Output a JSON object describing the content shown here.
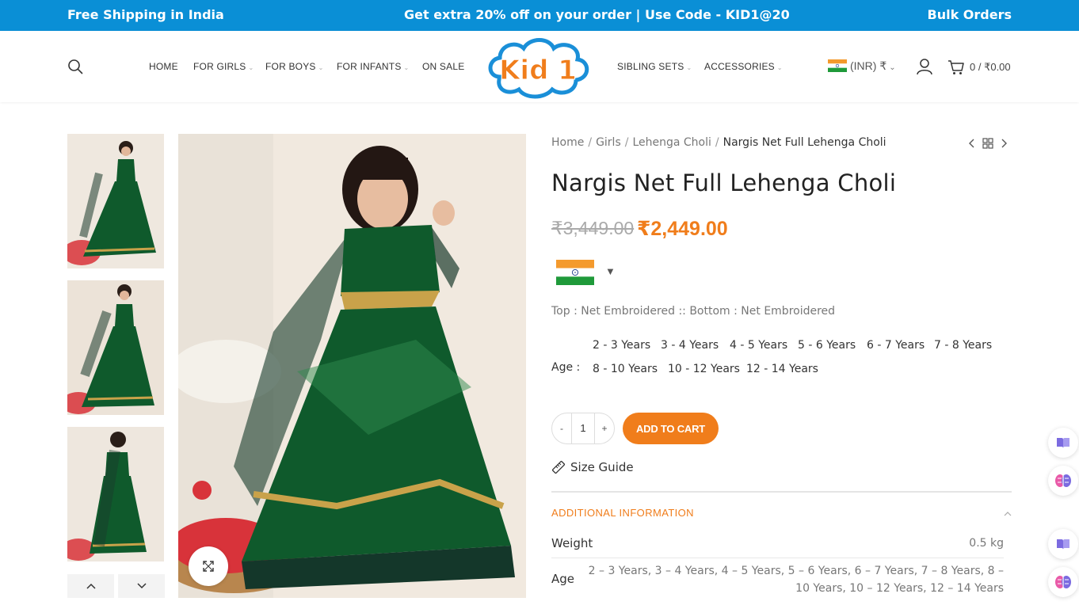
{
  "promo": {
    "left": "Free Shipping in India",
    "center": "Get extra 20% off on your order | Use Code - KID1@20",
    "right": "Bulk Orders"
  },
  "header": {
    "nav_left": [
      {
        "label": "HOME",
        "dropdown": false
      },
      {
        "label": "FOR GIRLS",
        "dropdown": true
      },
      {
        "label": "FOR BOYS",
        "dropdown": true
      },
      {
        "label": "FOR INFANTS",
        "dropdown": true
      },
      {
        "label": "ON SALE",
        "dropdown": false
      }
    ],
    "logo_text": "Kid 1",
    "nav_right": [
      {
        "label": "SIBLING SETS",
        "dropdown": true
      },
      {
        "label": "ACCESSORIES",
        "dropdown": true
      }
    ],
    "currency": "(INR) ₹",
    "cart_summary": "0 / ₹0.00"
  },
  "breadcrumb": {
    "items": [
      "Home",
      "Girls",
      "Lehenga Choli"
    ],
    "current": "Nargis Net Full Lehenga Choli"
  },
  "product": {
    "title": "Nargis Net Full Lehenga Choli",
    "price_old": "₹3,449.00",
    "price_new": "₹2,449.00",
    "material": "Top : Net Embroidered :: Bottom : Net Embroidered",
    "age_label": "Age :",
    "age_options": [
      "2 - 3 Years",
      "3 - 4 Years",
      "4 - 5 Years",
      "5 - 6 Years",
      "6 - 7 Years",
      "7 - 8 Years",
      "8 - 10 Years",
      "10 - 12 Years",
      "12 - 14 Years"
    ],
    "qty_minus": "-",
    "qty_value": "1",
    "qty_plus": "+",
    "add_to_cart": "ADD TO CART",
    "size_guide": "Size Guide"
  },
  "additional_info": {
    "title": "ADDITIONAL INFORMATION",
    "weight_label": "Weight",
    "weight_value": "0.5 kg",
    "age_label": "Age",
    "age_value": "2 – 3 Years, 3 – 4 Years, 4 – 5 Years, 5 – 6 Years, 6 – 7 Years, 7 – 8 Years, 8 – 10 Years, 10 – 12 Years, 12 – 14 Years"
  },
  "colors": {
    "promo_bg": "#0a8fd6",
    "accent_orange": "#f07d1b",
    "dress_green": "#0f5a2c"
  },
  "icons": [
    "search-icon",
    "user-icon",
    "cart-icon",
    "chevron-left-icon",
    "grid-icon",
    "chevron-right-icon",
    "expand-icon",
    "ruler-icon",
    "chevron-up-icon",
    "chevron-down-icon",
    "book-icon",
    "brain-icon"
  ]
}
